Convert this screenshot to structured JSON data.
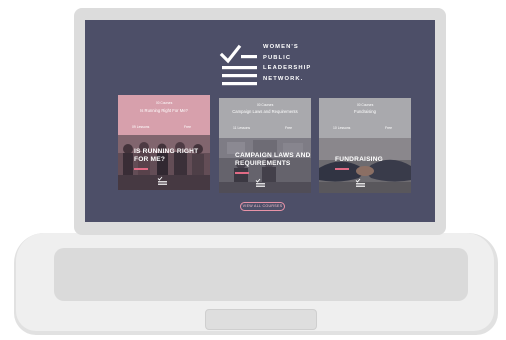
{
  "logo": {
    "lines": [
      "WOMEN'S",
      "PUBLIC",
      "LEADERSHIP",
      "NETWORK."
    ]
  },
  "courses": [
    {
      "course_label": "00 Courses",
      "subtitle": "Is Running Right For Me?",
      "lessons": "09 Lessons",
      "price": "Free",
      "title_line1": "IS RUNNING RIGHT",
      "title_line2": "FOR ME?",
      "top_color": "#d7a0ac"
    },
    {
      "course_label": "00 Courses",
      "subtitle": "Campaign Laws and Requirements",
      "lessons": "11 Lessons",
      "price": "Free",
      "title_line1": "CAMPAIGN LAWS AND",
      "title_line2": "REQUIREMENTS",
      "top_color": "#a9a9ad"
    },
    {
      "course_label": "00 Courses",
      "subtitle": "Fundraising",
      "lessons": "10 Lessons",
      "price": "Free",
      "title_line1": "FUNDRAISING",
      "title_line2": "",
      "top_color": "#a9a9ad"
    }
  ],
  "view_all_label": "VIEW ALL COURSES",
  "colors": {
    "screen_bg": "#4d4f68",
    "accent": "#e06b85"
  }
}
